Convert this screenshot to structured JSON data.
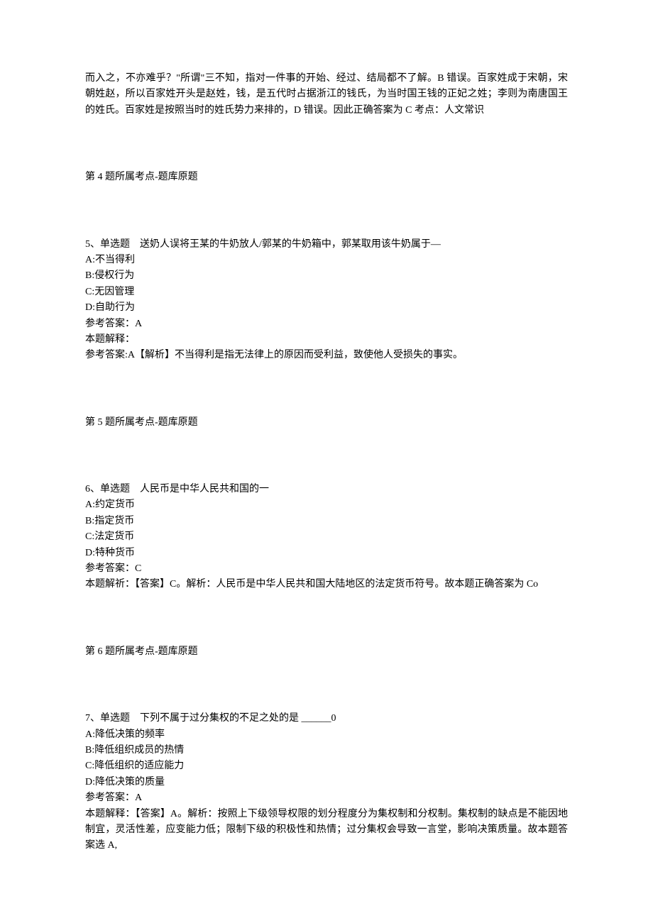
{
  "intro_continuation": "而入之，不亦难乎？\"所谓\"三不知，指对一件事的开始、经过、结局都不了解。B 错误。百家姓成于宋朝，宋朝姓赵，所以百家姓开头是赵姓，钱，是五代时占据浙江的钱氏，为当时国王钱的正妃之姓；李则为南唐国王的姓氏。百家姓是按照当时的姓氏势力来排的，D 错误。因此正确答案为 C 考点：人文常识",
  "q4_topic": "第 4 题所属考点-题库原题",
  "q5": {
    "prefix": "5、单选题",
    "stem": "送奶人误将王某的牛奶放人/郭某的牛奶箱中，郭某取用该牛奶属于—",
    "opt_a": "A:不当得利",
    "opt_b": "B:侵权行为",
    "opt_c": "C:无因管理",
    "opt_d": "D:自助行为",
    "ans": "参考答案：A",
    "exp_label": "本题解释：",
    "exp_text": "参考答案:A【解析】不当得利是指无法律上的原因而受利益，致使他人受损失的事实。"
  },
  "q5_topic": "第 5 题所属考点-题库原题",
  "q6": {
    "prefix": "6、单选题",
    "stem": "人民币是中华人民共和国的一",
    "opt_a": "A:约定货币",
    "opt_b": "B:指定货币",
    "opt_c": "C:法定货币",
    "opt_d": "D:特种货币",
    "ans": "参考答案：C",
    "exp": "本题解祈：【答案】C。解析：人民币是中华人民共和国大陆地区的法定货币符号。故本题正确答案为 Co"
  },
  "q6_topic": "第 6 题所属考点-题库原题",
  "q7": {
    "prefix": "7、单选题",
    "stem": "下列不属于过分集权的不足之处的是 ______0",
    "opt_a": "A:降低决策的频率",
    "opt_b": "B:降低组织成员的热情",
    "opt_c": "C:降低组织的适应能力",
    "opt_d": "D:降低决策的质量",
    "ans": "参考答案：A",
    "exp": "本题解释：【答案】A。解析：按照上下级领导权限的划分程度分为集权制和分权制。集权制的缺点是不能因地制宜，灵活性差，应变能力低；限制下级的积极性和热情；过分集权会导致一言堂，影响决策质量。故本题答案选 A,"
  }
}
